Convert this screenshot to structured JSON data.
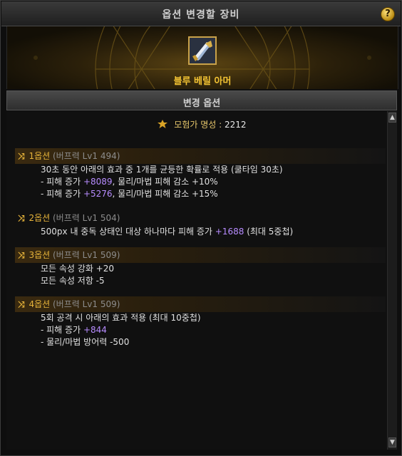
{
  "window": {
    "title": "옵션 변경할 장비",
    "help_label": "?"
  },
  "item": {
    "name": "블루 베릴 아머"
  },
  "section": {
    "title": "변경 옵션"
  },
  "adventurer": {
    "label": "모험가 명성",
    "separator": ":",
    "value": "2212"
  },
  "options": [
    {
      "name": "1옵션",
      "sub": "(버프력 Lv1 494)",
      "lines": [
        {
          "pre": "30초 동안 아래의 효과 중 1개를 균등한 확률로 적용 (쿨타임 30초)",
          "hl": "",
          "post": ""
        },
        {
          "pre": "- 피해 증가 ",
          "hl": "+8089",
          "post": ", 물리/마법 피해 감소 +10%"
        },
        {
          "pre": "- 피해 증가 ",
          "hl": "+5276",
          "post": ", 물리/마법 피해 감소 +15%"
        }
      ]
    },
    {
      "name": "2옵션",
      "sub": "(버프력 Lv1 504)",
      "lines": [
        {
          "pre": "500px 내 중독 상태인 대상 하나마다 피해 증가 ",
          "hl": "+1688",
          "post": " (최대 5중첩)"
        }
      ]
    },
    {
      "name": "3옵션",
      "sub": "(버프력 Lv1 509)",
      "lines": [
        {
          "pre": "모든 속성 강화 +20",
          "hl": "",
          "post": ""
        },
        {
          "pre": "모든 속성 저항 -5",
          "hl": "",
          "post": ""
        }
      ]
    },
    {
      "name": "4옵션",
      "sub": "(버프력 Lv1 509)",
      "lines": [
        {
          "pre": "5회 공격 시 아래의 효과 적용 (최대 10중첩)",
          "hl": "",
          "post": ""
        },
        {
          "pre": "- 피해 증가 ",
          "hl": "+844",
          "post": ""
        },
        {
          "pre": "- 물리/마법 방어력 -500",
          "hl": "",
          "post": ""
        }
      ]
    }
  ],
  "scroll": {
    "up": "▲",
    "down": "▼"
  },
  "colors": {
    "gold": "#e6b33a",
    "purple": "#b78cff",
    "item_name": "#f2c233"
  }
}
